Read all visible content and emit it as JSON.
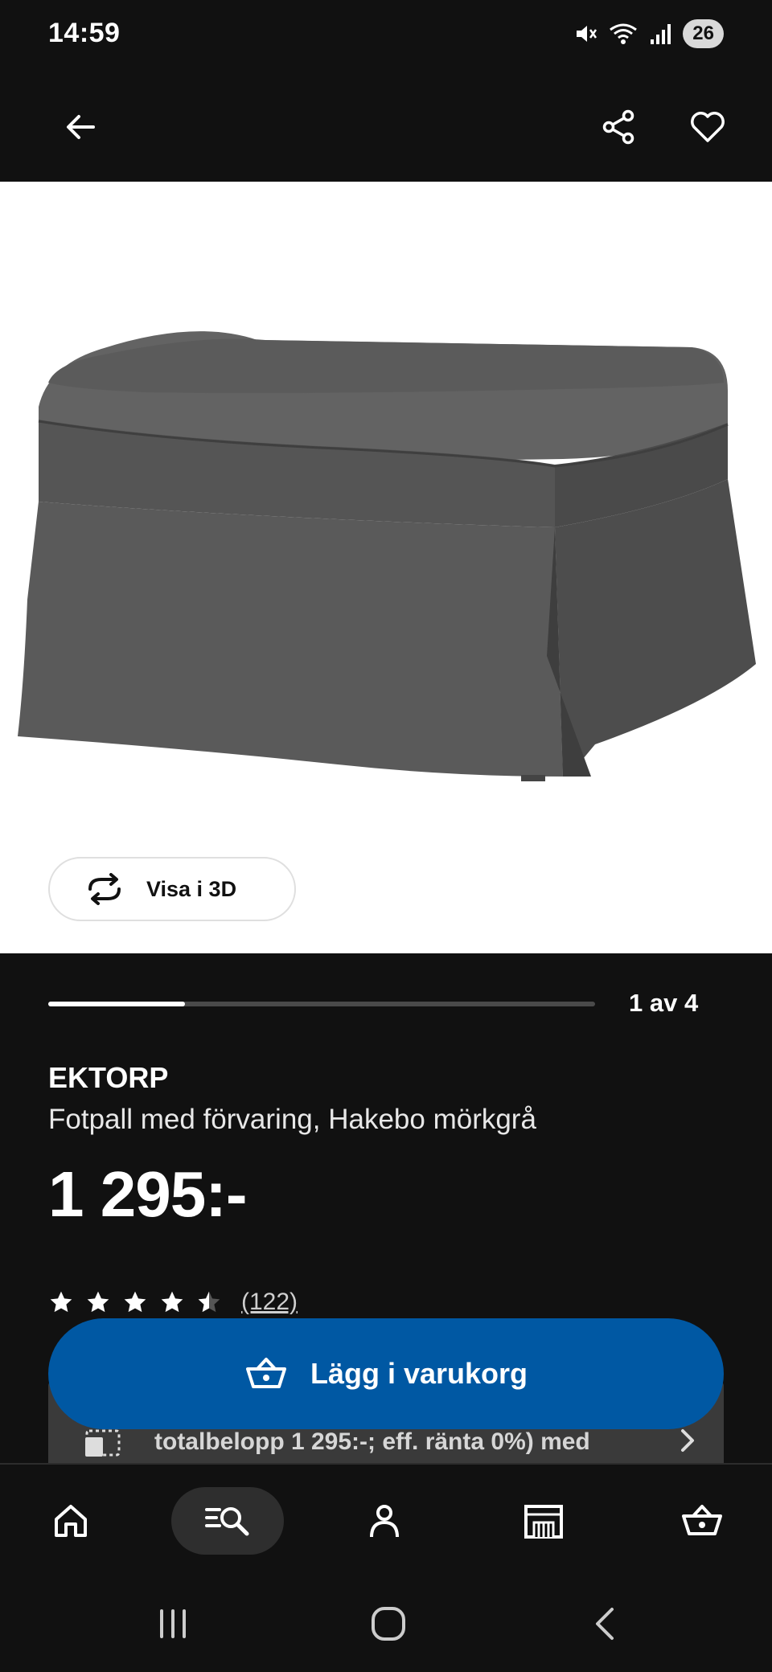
{
  "status_bar": {
    "time": "14:59",
    "battery": "26",
    "icons": [
      "mute-icon",
      "wifi-icon",
      "signal-icon"
    ]
  },
  "top_nav": {
    "back_icon": "arrow-left-icon",
    "share_icon": "share-icon",
    "favorite_icon": "heart-icon"
  },
  "gallery": {
    "view_3d_label": "Visa i 3D",
    "counter": "1 av 4",
    "current": 1,
    "total": 4
  },
  "product": {
    "brand": "EKTORP",
    "description": "Fotpall med förvaring, Hakebo mörkgrå",
    "price": "1 295:-",
    "rating": 4.5,
    "review_count": "(122)"
  },
  "finance_banner": {
    "text": "totalbelopp 1 295:-; eff. ränta 0%) med"
  },
  "cta": {
    "add_to_cart_label": "Lägg i varukorg",
    "color": "#0058a3"
  },
  "bottom_nav": {
    "tabs": [
      {
        "icon": "home-icon",
        "active": false
      },
      {
        "icon": "search-icon",
        "active": true
      },
      {
        "icon": "profile-icon",
        "active": false
      },
      {
        "icon": "store-icon",
        "active": false
      },
      {
        "icon": "basket-icon",
        "active": false
      }
    ]
  }
}
